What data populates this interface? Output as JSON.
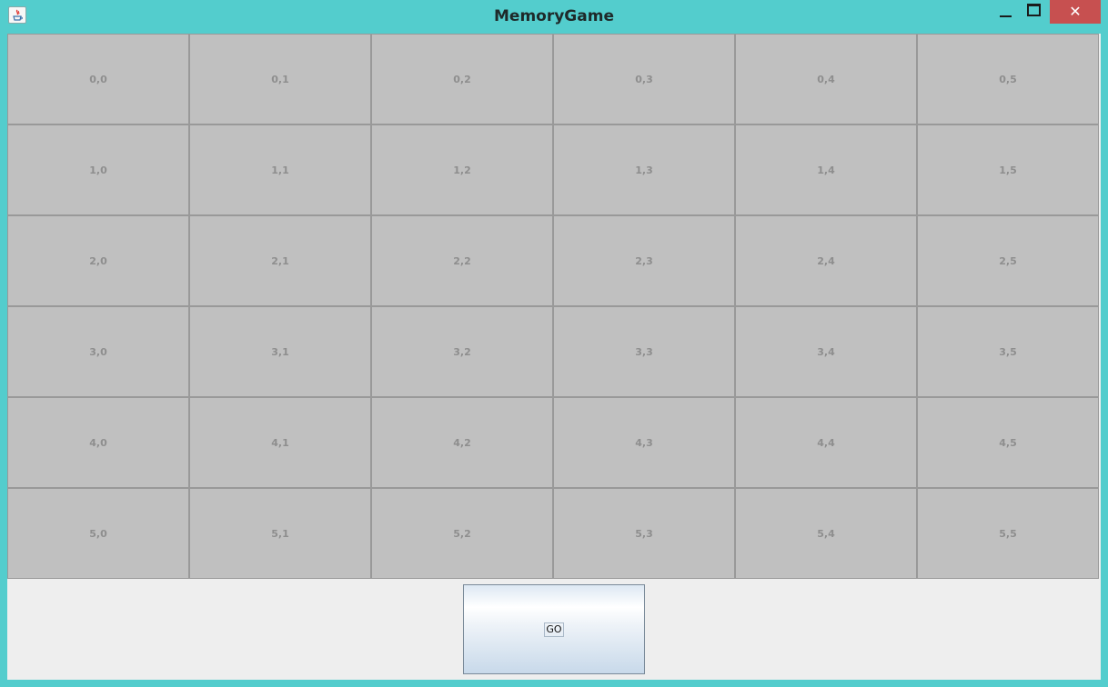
{
  "window": {
    "title": "MemoryGame",
    "icon": "java-icon",
    "controls": [
      "minimize-icon",
      "maximize-icon",
      "close-icon"
    ],
    "close_symbol": "✕",
    "frame_color": "#53cdcd",
    "close_color": "#c75050"
  },
  "grid": {
    "rows": [
      [
        "0,0",
        "0,1",
        "0,2",
        "0,3",
        "0,4",
        "0,5"
      ],
      [
        "1,0",
        "1,1",
        "1,2",
        "1,3",
        "1,4",
        "1,5"
      ],
      [
        "2,0",
        "2,1",
        "2,2",
        "2,3",
        "2,4",
        "2,5"
      ],
      [
        "3,0",
        "3,1",
        "3,2",
        "3,3",
        "3,4",
        "3,5"
      ],
      [
        "4,0",
        "4,1",
        "4,2",
        "4,3",
        "4,4",
        "4,5"
      ],
      [
        "5,0",
        "5,1",
        "5,2",
        "5,3",
        "5,4",
        "5,5"
      ]
    ],
    "cell_color": "#c0c0c0",
    "label_color": "#8e8e8e"
  },
  "controls": {
    "go_label": "GO"
  }
}
